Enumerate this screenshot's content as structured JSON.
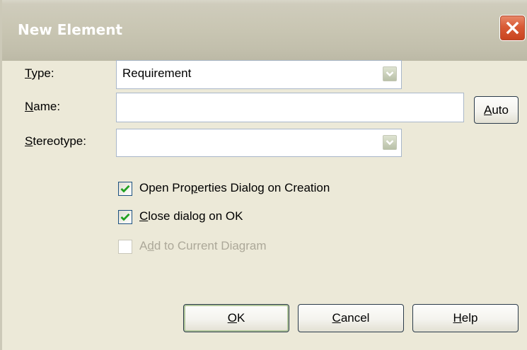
{
  "window": {
    "title": "New Element"
  },
  "form": {
    "type_label": {
      "pre": "",
      "key": "T",
      "post": "ype:"
    },
    "type_value": "Requirement",
    "name_label": {
      "pre": "",
      "key": "N",
      "post": "ame:"
    },
    "name_value": "",
    "auto_label": {
      "pre": "",
      "key": "A",
      "post": "uto"
    },
    "stereotype_label": {
      "pre": "",
      "key": "S",
      "post": "tereotype:"
    },
    "stereotype_value": ""
  },
  "options": [
    {
      "pre": "Open Pro",
      "key": "p",
      "post": "erties Dialog on Creation",
      "checked": true,
      "enabled": true
    },
    {
      "pre": "",
      "key": "C",
      "post": "lose dialog on OK",
      "checked": true,
      "enabled": true
    },
    {
      "pre": "A",
      "key": "d",
      "post": "d to Current Diagram",
      "checked": false,
      "enabled": false
    }
  ],
  "buttons": {
    "ok": {
      "pre": "",
      "key": "O",
      "post": "K"
    },
    "cancel": {
      "pre": "",
      "key": "C",
      "post": "ancel"
    },
    "help": {
      "pre": "",
      "key": "H",
      "post": "elp"
    }
  },
  "colors": {
    "title_text": "#ffffff",
    "close_button": "#d95b36",
    "dialog_background": "#ece9d8",
    "checkmark": "#21a121",
    "disabled_text": "#aca899"
  },
  "icons": {
    "close": "close-x-icon",
    "dropdown": "chevron-down-icon",
    "check": "checkmark-icon"
  }
}
